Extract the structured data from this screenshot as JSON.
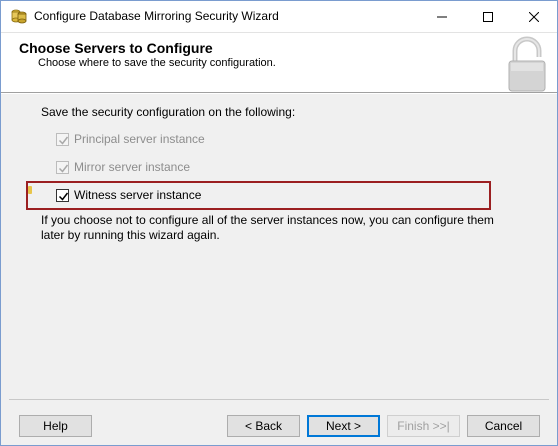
{
  "window": {
    "title": "Configure Database Mirroring Security Wizard"
  },
  "header": {
    "title": "Choose Servers to Configure",
    "subtitle": "Choose where to save the security configuration."
  },
  "content": {
    "prompt": "Save the security configuration on the following:",
    "options": [
      {
        "label": "Principal server instance",
        "checked": true,
        "enabled": false
      },
      {
        "label": "Mirror server instance",
        "checked": true,
        "enabled": false
      },
      {
        "label": "Witness server instance",
        "checked": true,
        "enabled": true
      }
    ],
    "info": "If you choose not to configure all of the server instances now, you can configure them later by running this wizard again.",
    "highlight_color": "#9b1f21"
  },
  "buttons": {
    "help": "Help",
    "back": "< Back",
    "next": "Next >",
    "finish": "Finish >>|",
    "cancel": "Cancel"
  },
  "icons": {
    "app": "database-wizard-icon",
    "header": "padlock-icon"
  }
}
